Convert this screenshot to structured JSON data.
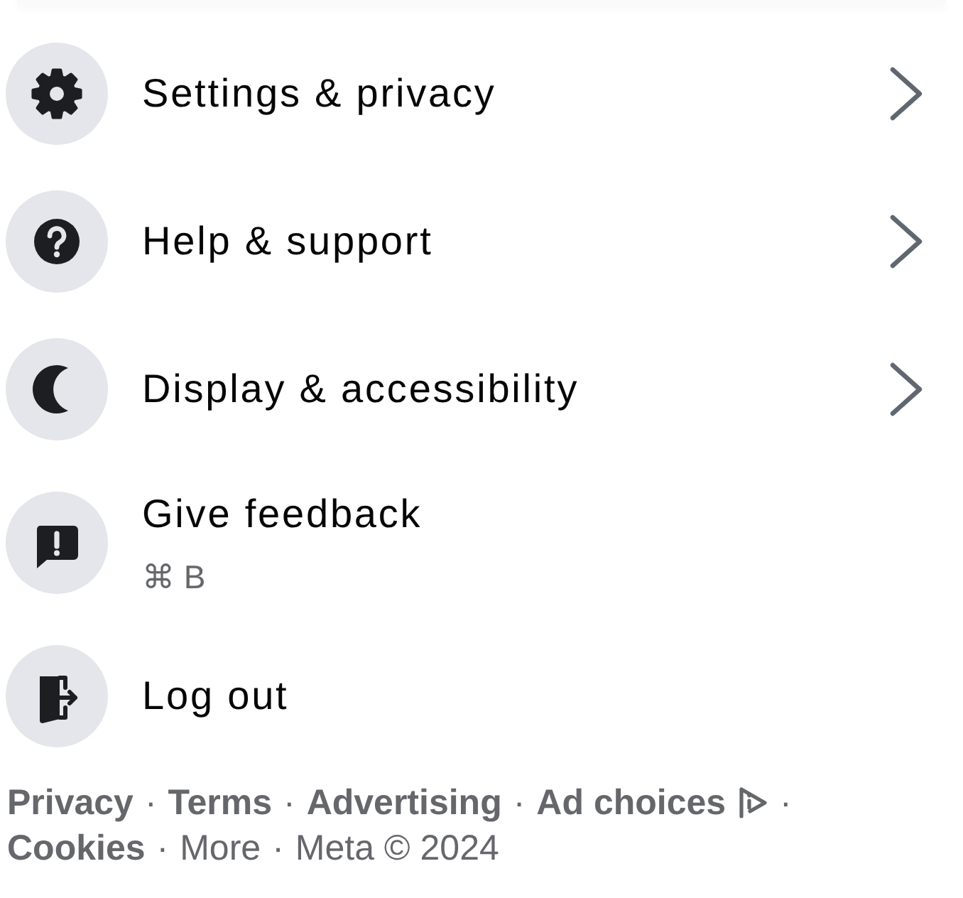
{
  "menu_items": [
    {
      "kind": "submenu",
      "label": "Settings & privacy"
    },
    {
      "kind": "submenu",
      "label": "Help & support"
    },
    {
      "kind": "submenu",
      "label": "Display & accessibility"
    },
    {
      "kind": "action",
      "label": "Give feedback",
      "shortcut": "⌘ B"
    },
    {
      "kind": "action",
      "label": "Log out"
    }
  ],
  "footer": {
    "lines": [
      [
        {
          "kind": "link",
          "label": "Privacy"
        },
        {
          "kind": "separator",
          "label": "·"
        },
        {
          "kind": "link",
          "label": "Terms"
        },
        {
          "kind": "separator",
          "label": "·"
        },
        {
          "kind": "link",
          "label": "Advertising"
        },
        {
          "kind": "separator",
          "label": "·"
        },
        {
          "kind": "icon-link",
          "label": "Ad choices"
        },
        {
          "kind": "separator",
          "label": "·"
        }
      ],
      [
        {
          "kind": "link",
          "label": "Cookies"
        },
        {
          "kind": "separator",
          "label": "·"
        },
        {
          "kind": "plain-link",
          "label": "More"
        },
        {
          "kind": "separator",
          "label": "·"
        },
        {
          "kind": "text",
          "label": "Meta © 2024"
        }
      ]
    ]
  }
}
